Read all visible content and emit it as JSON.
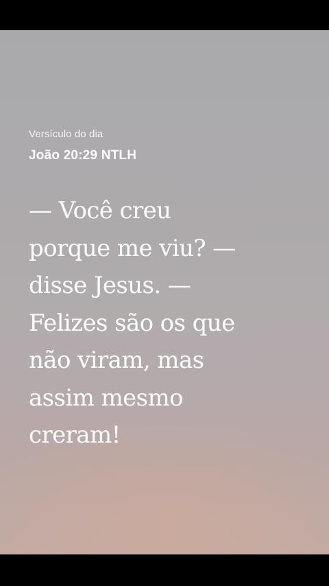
{
  "verse_of_the_day": {
    "label": "Versículo do dia",
    "reference": "João 20:29 NTLH",
    "text": "— Você creu\nporque me viu? —\ndisse Jesus. —\nFelizes são os que\nnão viram, mas\nassim mesmo\ncreram!"
  },
  "colors": {
    "background_top": "#a9a9ab",
    "background_bottom": "#c2aba4",
    "text": "#ffffff",
    "frame": "#000000"
  }
}
